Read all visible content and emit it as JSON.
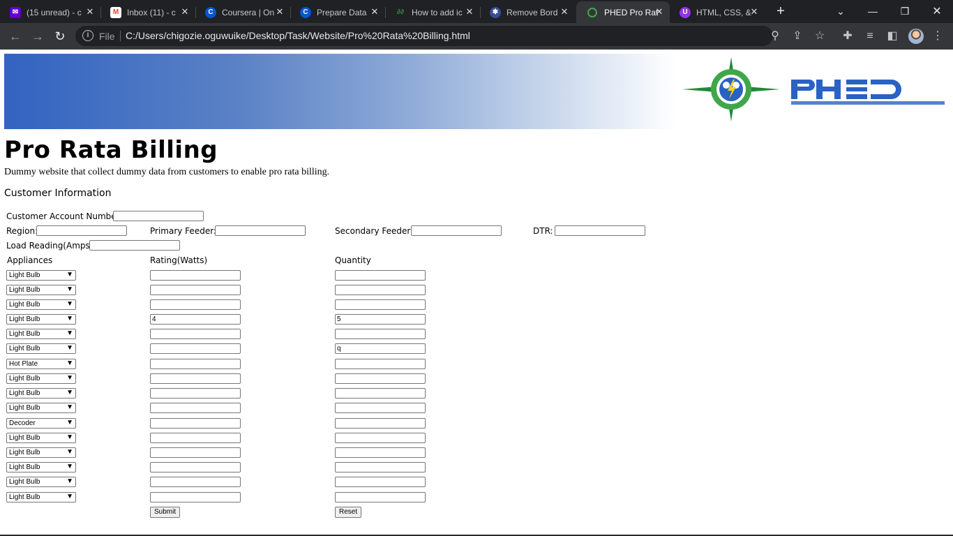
{
  "browser": {
    "tabs": [
      {
        "title": "(15 unread) - c",
        "icon": "yahoo-mail-icon",
        "color": "#6001d2"
      },
      {
        "title": "Inbox (11) - c",
        "icon": "gmail-icon",
        "color": "#ea4335"
      },
      {
        "title": "Coursera | On",
        "icon": "coursera-icon",
        "color": "#0056d2"
      },
      {
        "title": "Prepare Data",
        "icon": "coursera-icon",
        "color": "#0056d2"
      },
      {
        "title": "How to add ic",
        "icon": "geeksforgeeks-icon",
        "color": "#2f8d46"
      },
      {
        "title": "Remove Bord",
        "icon": "site-icon",
        "color": "#3a4a9a"
      },
      {
        "title": "PHED Pro Rat",
        "icon": "phed-icon",
        "color": "#3fa74a"
      },
      {
        "title": "HTML, CSS, &",
        "icon": "w3-icon",
        "color": "#9334e6"
      }
    ],
    "file_label": "File",
    "url": "C:/Users/chigozie.oguwuike/Desktop/Task/Website/Pro%20Rata%20Billing.html"
  },
  "page": {
    "title": "Pro Rata Billing",
    "description": "Dummy website that collect dummy data from customers to enable pro rata billing.",
    "section_title": "Customer Information",
    "labels": {
      "account_number": "Customer Account Number",
      "region": "Region:",
      "primary_feeder": "Primary Feeder:",
      "secondary_feeder": "Secondary Feeder:",
      "dtr": "DTR:",
      "load_reading": "Load Reading(Amps):",
      "appliances": "Appliances",
      "rating": "Rating(Watts)",
      "quantity": "Quantity"
    },
    "rows": [
      {
        "appliance": "Light Bulb",
        "rating": "",
        "quantity": ""
      },
      {
        "appliance": "Light Bulb",
        "rating": "",
        "quantity": ""
      },
      {
        "appliance": "Light Bulb",
        "rating": "",
        "quantity": ""
      },
      {
        "appliance": "Light Bulb",
        "rating": "4",
        "quantity": "5"
      },
      {
        "appliance": "Light Bulb",
        "rating": "",
        "quantity": ""
      },
      {
        "appliance": "Light Bulb",
        "rating": "",
        "quantity": "q"
      },
      {
        "appliance": "Hot Plate",
        "rating": "",
        "quantity": ""
      },
      {
        "appliance": "Light Bulb",
        "rating": "",
        "quantity": ""
      },
      {
        "appliance": "Light Bulb",
        "rating": "",
        "quantity": ""
      },
      {
        "appliance": "Light Bulb",
        "rating": "",
        "quantity": ""
      },
      {
        "appliance": "Decoder",
        "rating": "",
        "quantity": ""
      },
      {
        "appliance": "Light Bulb",
        "rating": "",
        "quantity": ""
      },
      {
        "appliance": "Light Bulb",
        "rating": "",
        "quantity": ""
      },
      {
        "appliance": "Light Bulb",
        "rating": "",
        "quantity": ""
      },
      {
        "appliance": "Light Bulb",
        "rating": "",
        "quantity": ""
      },
      {
        "appliance": "Light Bulb",
        "rating": "",
        "quantity": ""
      }
    ],
    "submit_label": "Submit",
    "reset_label": "Reset"
  }
}
